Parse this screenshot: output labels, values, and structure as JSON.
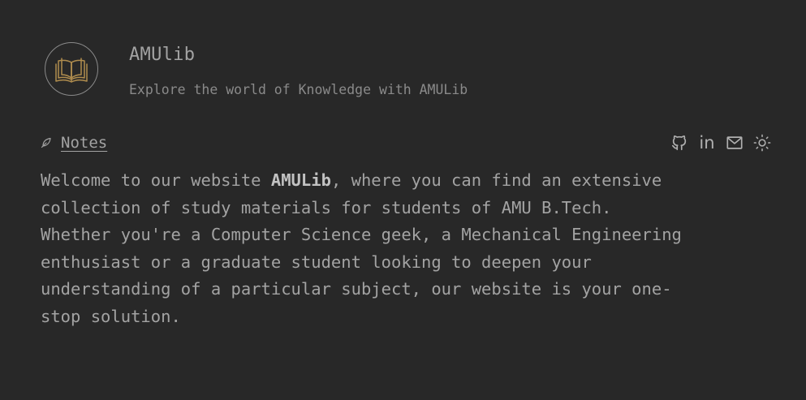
{
  "header": {
    "logo_icon": "open-book-icon",
    "title": "AMUlib",
    "subtitle": "Explore the world of Knowledge with AMULib"
  },
  "nav": {
    "notes_icon": "leaf-icon",
    "notes_label": "Notes",
    "social_icons": [
      "github-icon",
      "linkedin-icon",
      "mail-icon",
      "sun-icon"
    ],
    "linkedin_text": "in"
  },
  "intro": {
    "line1_prefix": "Welcome to our website ",
    "line1_bold": "AMULib",
    "line1_suffix": ", where you can find an extensive",
    "line2": "collection of study materials for students of AMU B.Tech.",
    "line3": "Whether you're a Computer Science geek, a Mechanical Engineering",
    "line4": "enthusiast or a graduate student looking to deepen your",
    "line5": "understanding of a particular subject, our website is your one-",
    "line6": "stop solution."
  },
  "colors": {
    "background": "#282828",
    "text": "#a3a3a3",
    "muted": "#8a8a8a",
    "logo_accent": "#b08d4e"
  }
}
